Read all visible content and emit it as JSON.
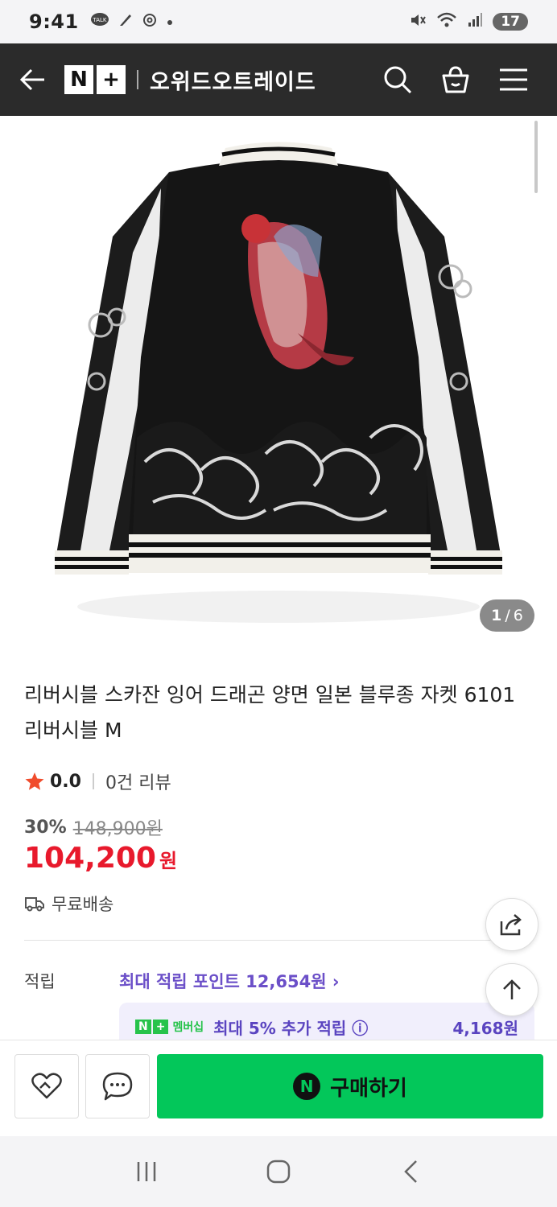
{
  "status_bar": {
    "time": "9:41",
    "battery": "17"
  },
  "header": {
    "logo_n": "N",
    "logo_plus": "+",
    "store_name": "오위드오트레이드"
  },
  "gallery": {
    "current": "1",
    "separator": "/",
    "total": "6"
  },
  "product": {
    "title": "리버시블 스카잔 잉어 드래곤 양면 일본 블루종 자켓 6101 리버시블 M",
    "rating": "0.0",
    "review_count": "0건 리뷰",
    "discount_rate": "30%",
    "original_price": "148,900원",
    "price": "104,200",
    "price_unit": "원",
    "shipping": "무료배송"
  },
  "points": {
    "label": "적립",
    "max_points": "최대 적립 포인트 12,654원 ›",
    "membership_badge": "N",
    "membership_plus": "+",
    "membership_label": "멤버십",
    "membership_text": "최대 5% 추가 적립 ⓘ",
    "membership_amount": "4,168원"
  },
  "bottom_bar": {
    "buy_icon": "N",
    "buy_label": "구매하기"
  },
  "colors": {
    "header_bg": "#2b2b2b",
    "price_red": "#e8192c",
    "buy_green": "#03c75a",
    "points_purple": "#6b4fc8"
  }
}
